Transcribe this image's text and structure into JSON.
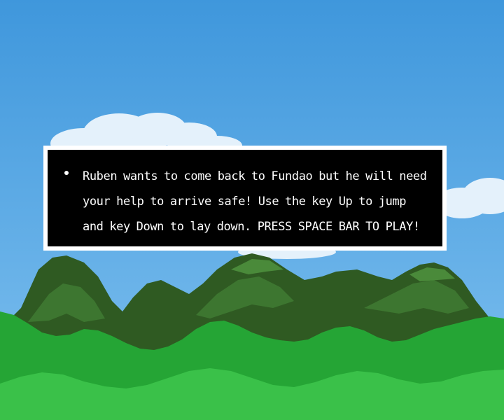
{
  "dialog": {
    "text": "Ruben wants to come back to Fundao but he will need your help to arrive safe! Use the key Up to jump and key Down to lay down. PRESS SPACE BAR TO PLAY!"
  },
  "colors": {
    "sky_top": "#3f97dc",
    "sky_bottom": "#7ec0ef",
    "cloud": "#e4f1fb",
    "mountain_dark": "#2f5a22",
    "mountain_mid": "#3d7630",
    "mountain_light": "#4a8a3a",
    "hill_front": "#25a535",
    "hill_lower": "#3ac149",
    "dialog_border": "#ffffff",
    "dialog_fill": "#000000",
    "dialog_text": "#ffffff"
  }
}
